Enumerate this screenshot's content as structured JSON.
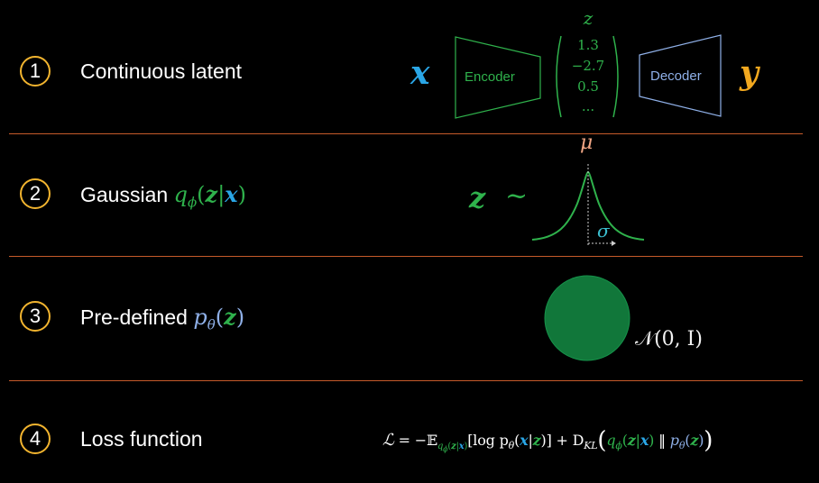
{
  "rows": [
    {
      "number": "1",
      "label": "Continuous latent"
    },
    {
      "number": "2",
      "label": "Gaussian "
    },
    {
      "number": "3",
      "label": "Pre-defined "
    },
    {
      "number": "4",
      "label": "Loss function"
    }
  ],
  "row1": {
    "x": "x",
    "encoder": "Encoder",
    "decoder": "Decoder",
    "y": "y",
    "z_title": "z",
    "z_values": [
      "1.3",
      "−2.7",
      "0.5",
      "..."
    ]
  },
  "row2": {
    "q": "q",
    "phi": "ϕ",
    "open": "(",
    "z": "z",
    "bar": "|",
    "x": "x",
    "close": ")",
    "lhs_z": "z",
    "tilde": "~",
    "mu": "μ",
    "sigma": "σ"
  },
  "row3": {
    "p": "p",
    "theta": "θ",
    "open": "(",
    "z": "z",
    "close": ")",
    "normal": "𝒩(0, I)"
  },
  "row4": {
    "loss": {
      "L": "ℒ",
      "eq": " = −𝔼",
      "sub_q": "q",
      "sub_phi": "ϕ",
      "sub_open": "(",
      "sub_z": "z",
      "sub_bar": "|",
      "sub_x": "x",
      "sub_close": ")",
      "log": "[log p",
      "theta": "θ",
      "open": "(",
      "x": "x",
      "bar": "|",
      "z": "z",
      "close": ")]",
      "plus": " + D",
      "kl": "KL",
      "bigopen": "(",
      "q": "q",
      "phi": "ϕ",
      "q_open": "(",
      "q_z": "z",
      "q_bar": "|",
      "q_x": "x",
      "q_close": ")",
      "parallel": " ‖ ",
      "p": "p",
      "p_theta": "θ",
      "p_open": "(",
      "p_z": "z",
      "p_close": ")",
      "bigclose": ")"
    }
  },
  "colors": {
    "accent_ring": "#f2b42f",
    "separator": "#c65a2a",
    "latent_green": "#2fb24c",
    "input_blue": "#2aa6e6",
    "output_orange": "#f2a81f",
    "prior_blue": "#8fb0e8"
  }
}
